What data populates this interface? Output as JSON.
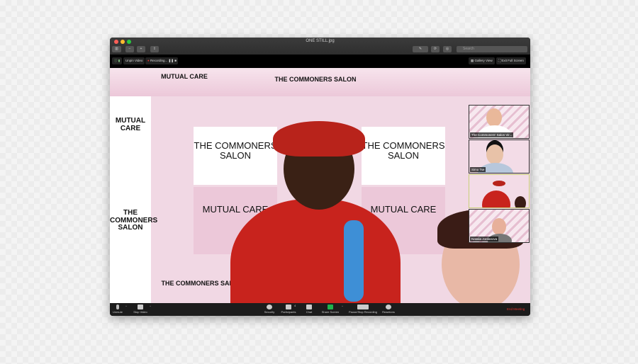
{
  "window": {
    "title": "ONE STILL.jpg",
    "search_placeholder": "Search"
  },
  "meeting_bar": {
    "unpin": "Unpin Video",
    "recording": "Recording...",
    "gallery": "Gallery View",
    "exit_full": "Exit Full Screen"
  },
  "scene": {
    "salon": "THE COMMONERS SALON",
    "care": "MUTUAL CARE"
  },
  "participants": [
    {
      "name": "The Commoners' Salon Vir..."
    },
    {
      "name": "Simo Tse"
    },
    {
      "name": ""
    },
    {
      "name": "Natalia Jordanova"
    }
  ],
  "controls": {
    "unmute": "Unmute",
    "stop_video": "Stop Video",
    "security": "Security",
    "participants": "Participants",
    "participants_count": "4",
    "chat": "Chat",
    "share": "Share Screen",
    "record": "Pause/Stop Recording",
    "reactions": "Reactions",
    "end": "End Meeting"
  },
  "colors": {
    "end": "#e0322e",
    "share": "#1db34c",
    "rec": "#e0322e"
  }
}
